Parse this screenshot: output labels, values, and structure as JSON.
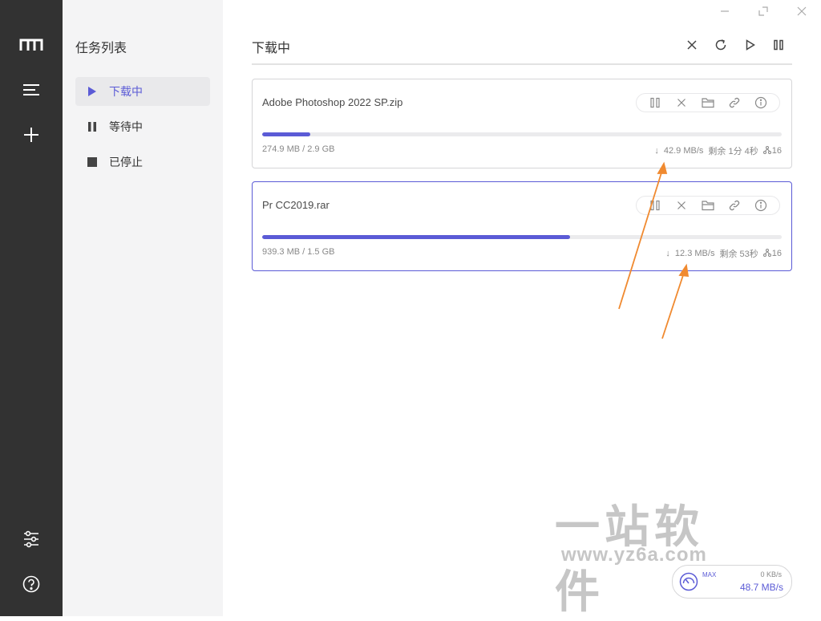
{
  "window": {
    "minimize_icon": "minimize-icon",
    "maximize_icon": "maximize-icon",
    "close_icon": "close-icon"
  },
  "rail": {
    "logo_icon": "motrix-logo-icon",
    "tasks_icon": "menu-lines-icon",
    "add_icon": "plus-icon",
    "settings_icon": "sliders-icon",
    "help_icon": "help-circle-icon"
  },
  "subnav": {
    "title": "任务列表",
    "items": [
      {
        "label": "下载中",
        "icon": "play-icon",
        "active": true
      },
      {
        "label": "等待中",
        "icon": "pause-icon",
        "active": false
      },
      {
        "label": "已停止",
        "icon": "stop-icon",
        "active": false
      }
    ]
  },
  "main": {
    "title": "下载中",
    "toolbar": [
      "close-icon",
      "refresh-icon",
      "play-icon",
      "pause-icon"
    ]
  },
  "tasks": [
    {
      "name": "Adobe Photoshop 2022 SP.zip",
      "progress": 0.092,
      "size": "274.9 MB / 2.9 GB",
      "speed": "42.9 MB/s",
      "remaining": "剩余 1分 4秒",
      "connections": "16",
      "selected": false
    },
    {
      "name": "Pr CC2019.rar",
      "progress": 0.593,
      "size": "939.3 MB / 1.5 GB",
      "speed": "12.3 MB/s",
      "remaining": "剩余 53秒",
      "connections": "16",
      "selected": true
    }
  ],
  "task_action_icons": [
    "pause-icon",
    "close-icon",
    "folder-icon",
    "link-icon",
    "info-icon"
  ],
  "speedometer": {
    "max_label": "MAX",
    "upload": "0 KB/s",
    "download": "48.7 MB/s"
  },
  "watermark": {
    "chinese": "一站软件",
    "url": "www.yz6a.com"
  },
  "colors": {
    "accent": "#5b5bd6",
    "rail": "#323232",
    "subnav": "#f4f4f5",
    "annotation_arrow": "#f08a30"
  }
}
